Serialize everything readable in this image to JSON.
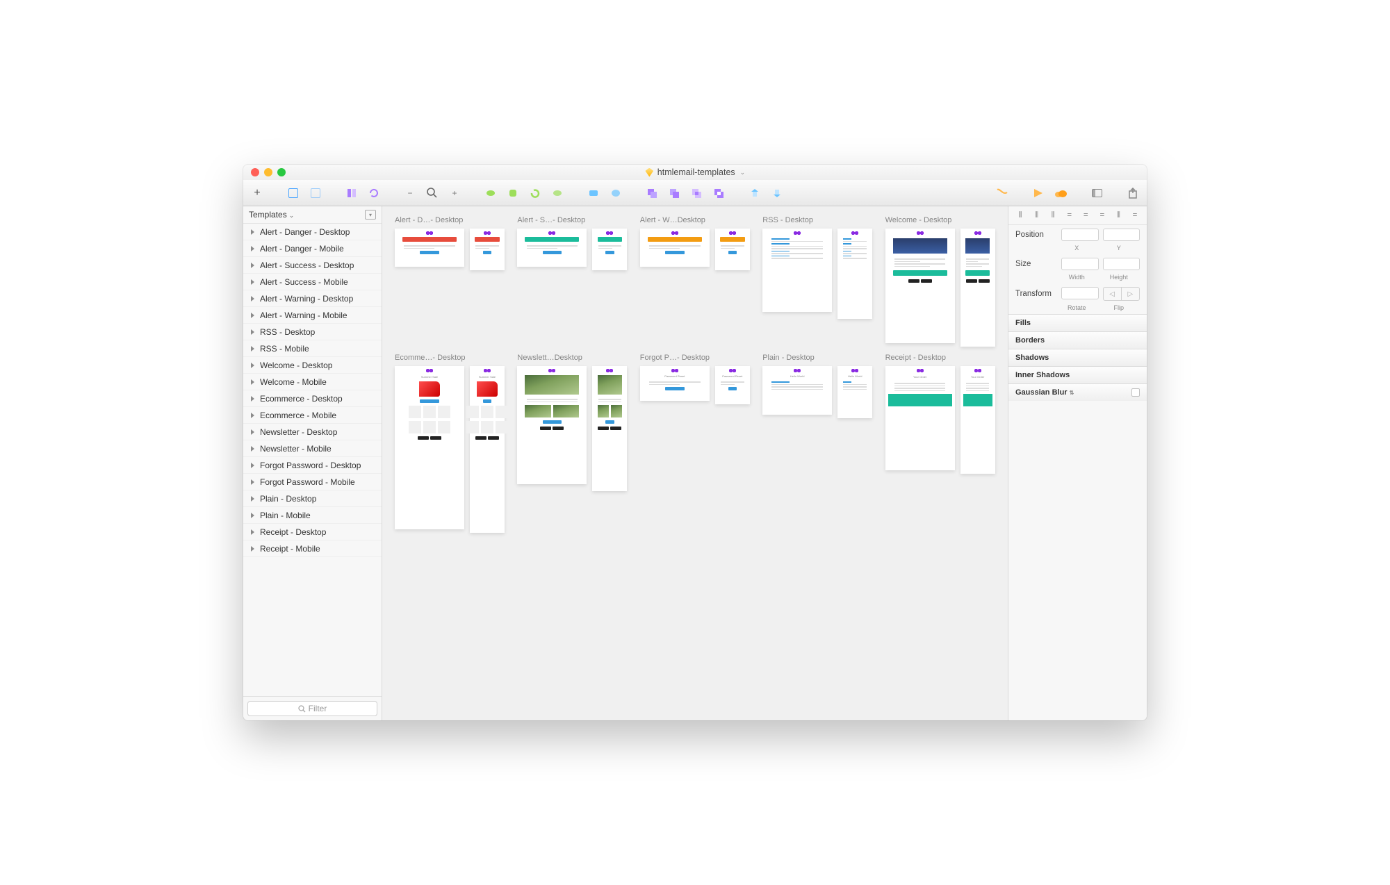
{
  "window": {
    "title": "htmlemail-templates"
  },
  "sidebar": {
    "panel_title": "Templates",
    "filter_placeholder": "Filter",
    "items": [
      {
        "label": "Alert - Danger - Desktop"
      },
      {
        "label": "Alert - Danger - Mobile"
      },
      {
        "label": "Alert - Success - Desktop"
      },
      {
        "label": "Alert - Success - Mobile"
      },
      {
        "label": "Alert - Warning - Desktop"
      },
      {
        "label": "Alert - Warning - Mobile"
      },
      {
        "label": "RSS - Desktop"
      },
      {
        "label": "RSS - Mobile"
      },
      {
        "label": "Welcome - Desktop"
      },
      {
        "label": "Welcome - Mobile"
      },
      {
        "label": "Ecommerce - Desktop"
      },
      {
        "label": "Ecommerce - Mobile"
      },
      {
        "label": "Newsletter - Desktop"
      },
      {
        "label": "Newsletter - Mobile"
      },
      {
        "label": "Forgot Password - Desktop"
      },
      {
        "label": "Forgot Password - Mobile"
      },
      {
        "label": "Plain - Desktop"
      },
      {
        "label": "Plain - Mobile"
      },
      {
        "label": "Receipt - Desktop"
      },
      {
        "label": "Receipt - Mobile"
      }
    ]
  },
  "artboards": [
    {
      "title": "Alert - D…- Desktop",
      "kind": "alert",
      "accent": "red"
    },
    {
      "title": "Alert - S…- Desktop",
      "kind": "alert",
      "accent": "green"
    },
    {
      "title": "Alert - W…Desktop",
      "kind": "alert",
      "accent": "orange"
    },
    {
      "title": "RSS - Desktop",
      "kind": "rss"
    },
    {
      "title": "Welcome - Desktop",
      "kind": "welcome"
    },
    {
      "title": "Ecomme…- Desktop",
      "kind": "ecom"
    },
    {
      "title": "Newslett…Desktop",
      "kind": "news"
    },
    {
      "title": "Forgot P…- Desktop",
      "kind": "forgot"
    },
    {
      "title": "Plain - Desktop",
      "kind": "plain"
    },
    {
      "title": "Receipt - Desktop",
      "kind": "receipt"
    }
  ],
  "inspector": {
    "position_label": "Position",
    "size_label": "Size",
    "transform_label": "Transform",
    "x_label": "X",
    "y_label": "Y",
    "width_label": "Width",
    "height_label": "Height",
    "rotate_label": "Rotate",
    "flip_label": "Flip",
    "sections": [
      "Fills",
      "Borders",
      "Shadows",
      "Inner Shadows",
      "Gaussian Blur"
    ]
  }
}
